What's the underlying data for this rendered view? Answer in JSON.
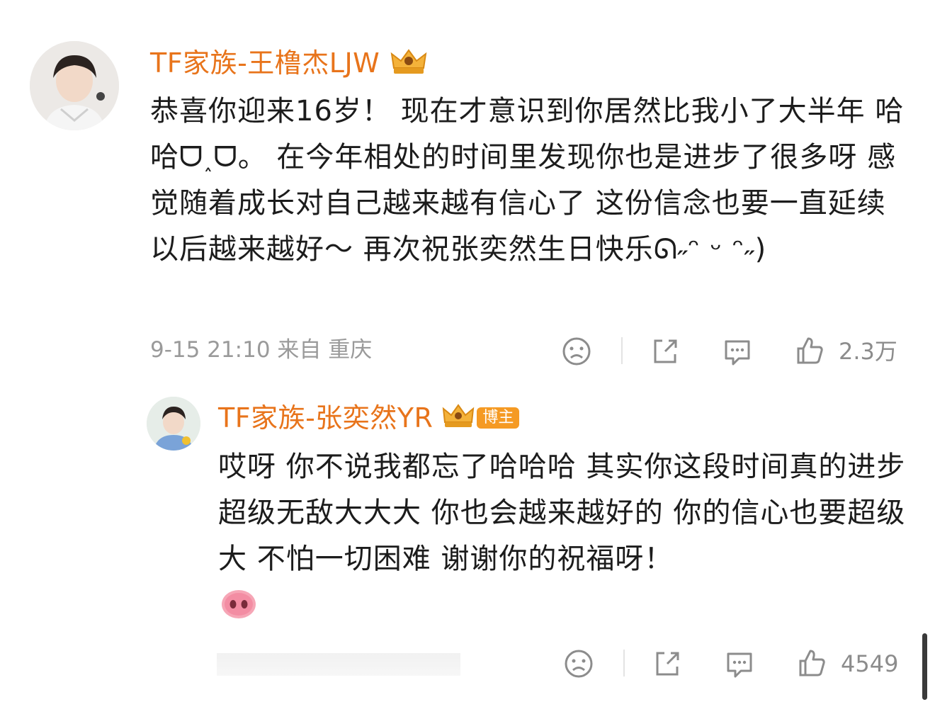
{
  "comment": {
    "username": "TF家族-王橹杰LJW",
    "text": "恭喜你迎来16岁！  现在才意识到你居然比我小了大半年 哈哈ᗜ˰ᗜ。  在今年相处的时间里发现你也是进步了很多呀  感觉随着成长对自己越来越有信心了  这份信念也要一直延续  以后越来越好～ 再次祝张奕然生日快乐ᘏ˶ᵔ ᵕ ᵔ˶)",
    "time_location": "9-15 21:10 来自 重庆",
    "likes": "2.3万"
  },
  "reply": {
    "username": "TF家族-张奕然YR",
    "badge": "博主",
    "text": "哎呀 你不说我都忘了哈哈哈 其实你这段时间真的进步超级无敌大大大  你也会越来越好的 你的信心也要超级大 不怕一切困难 谢谢你的祝福呀！",
    "likes": "4549"
  },
  "icons": {
    "dislike": "sad-face-icon",
    "share": "share-icon",
    "comment": "comment-bubble-icon",
    "like": "thumbs-up-icon",
    "crown": "crown-badge-icon",
    "pig": "pig-nose-emoji-icon"
  },
  "colors": {
    "username": "#e8741b",
    "text": "#1c1c1c",
    "meta": "#9a9a9a",
    "badge": "#f59a23"
  }
}
